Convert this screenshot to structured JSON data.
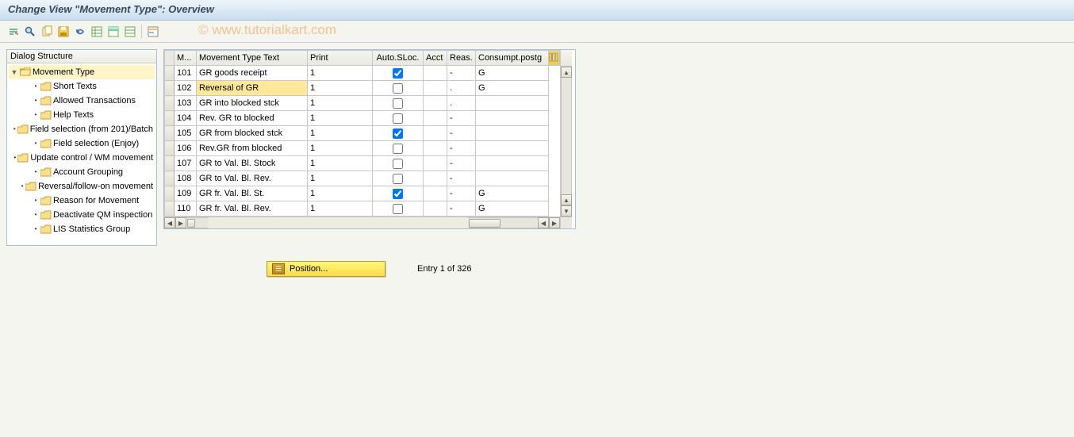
{
  "title": "Change View \"Movement Type\": Overview",
  "watermark": "© www.tutorialkart.com",
  "toolbar_icons": [
    "other-view",
    "find",
    "copy-as",
    "save",
    "undo",
    "select-all",
    "deselect-all",
    "config"
  ],
  "tree": {
    "header": "Dialog Structure",
    "root": {
      "label": "Movement Type",
      "expanded": true
    },
    "children": [
      "Short Texts",
      "Allowed Transactions",
      "Help Texts",
      "Field selection (from 201)/Batch",
      "Field selection (Enjoy)",
      "Update control / WM movement",
      "Account Grouping",
      "Reversal/follow-on movement",
      "Reason for Movement",
      "Deactivate QM inspection",
      "LIS Statistics Group"
    ]
  },
  "table": {
    "columns": [
      "M...",
      "Movement Type Text",
      "Print",
      "Auto.SLoc.",
      "Acct",
      "Reas.",
      "Consumpt.postg"
    ],
    "rows": [
      {
        "m": "101",
        "text": "GR goods receipt",
        "print": "1",
        "auto": true,
        "acct": "",
        "reas": "-",
        "cons": "G"
      },
      {
        "m": "102",
        "text": "Reversal of GR",
        "print": "1",
        "auto": false,
        "acct": "",
        "reas": ".",
        "cons": "G",
        "highlight": true
      },
      {
        "m": "103",
        "text": "GR into blocked stck",
        "print": "1",
        "auto": false,
        "acct": "",
        "reas": ".",
        "cons": ""
      },
      {
        "m": "104",
        "text": "Rev. GR to blocked",
        "print": "1",
        "auto": false,
        "acct": "",
        "reas": "-",
        "cons": ""
      },
      {
        "m": "105",
        "text": "GR from blocked stck",
        "print": "1",
        "auto": true,
        "acct": "",
        "reas": "-",
        "cons": ""
      },
      {
        "m": "106",
        "text": "Rev.GR from blocked",
        "print": "1",
        "auto": false,
        "acct": "",
        "reas": "-",
        "cons": ""
      },
      {
        "m": "107",
        "text": "GR to Val. Bl. Stock",
        "print": "1",
        "auto": false,
        "acct": "",
        "reas": "-",
        "cons": ""
      },
      {
        "m": "108",
        "text": "GR to Val. Bl. Rev.",
        "print": "1",
        "auto": false,
        "acct": "",
        "reas": "-",
        "cons": ""
      },
      {
        "m": "109",
        "text": "GR fr. Val. Bl. St.",
        "print": "1",
        "auto": true,
        "acct": "",
        "reas": "-",
        "cons": "G"
      },
      {
        "m": "110",
        "text": "GR fr. Val. Bl. Rev.",
        "print": "1",
        "auto": false,
        "acct": "",
        "reas": "-",
        "cons": "G"
      }
    ]
  },
  "position_button": "Position...",
  "entry_info": "Entry 1 of 326"
}
